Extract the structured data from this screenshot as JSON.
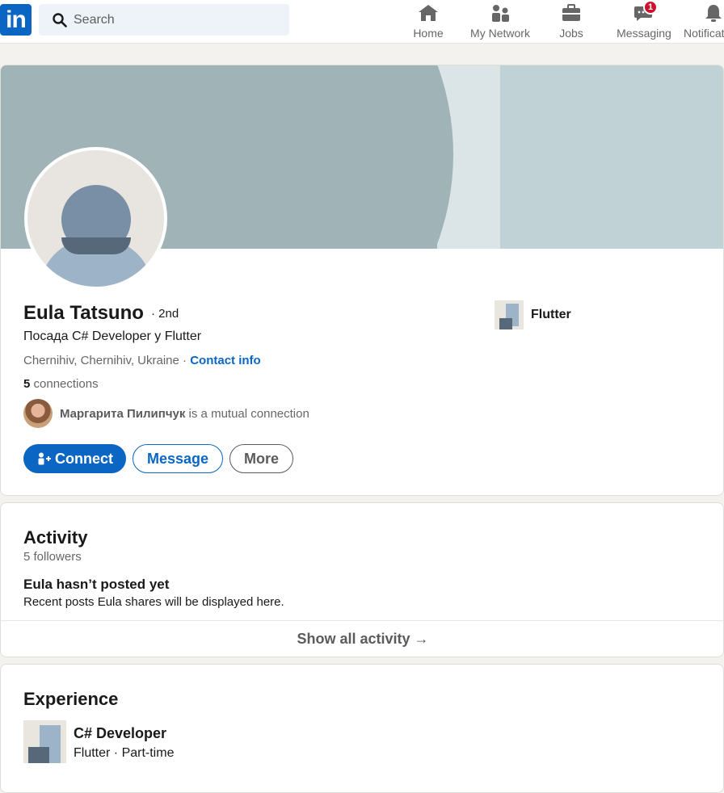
{
  "nav": {
    "logo": "in",
    "search_placeholder": "Search",
    "items": [
      {
        "label": "Home",
        "icon": "home-icon"
      },
      {
        "label": "My Network",
        "icon": "network-icon"
      },
      {
        "label": "Jobs",
        "icon": "briefcase-icon"
      },
      {
        "label": "Messaging",
        "icon": "messaging-icon",
        "badge": "1"
      },
      {
        "label": "Notifications",
        "icon": "bell-icon"
      }
    ]
  },
  "profile": {
    "name": "Eula Tatsuno",
    "degree": "· 2nd",
    "headline": "Посада C# Developer у Flutter",
    "location": "Chernihiv, Chernihiv, Ukraine",
    "location_sep": " · ",
    "contact_info": "Contact info",
    "connections_count": "5",
    "connections_label": " connections",
    "mutual_name": "Маргарита Пилипчук",
    "mutual_suffix": " is a mutual connection",
    "buttons": {
      "connect": "Connect",
      "message": "Message",
      "more": "More"
    },
    "company": "Flutter"
  },
  "activity": {
    "title": "Activity",
    "followers": "5 followers",
    "empty_title": "Eula hasn’t posted yet",
    "empty_desc": "Recent posts Eula shares will be displayed here.",
    "show_all": "Show all activity →"
  },
  "experience": {
    "title": "Experience",
    "items": [
      {
        "role": "C# Developer",
        "company_type": "Flutter · Part-time"
      }
    ]
  },
  "colors": {
    "brand": "#0a66c2",
    "badge": "#cb112d",
    "page_bg": "#f4f2ee"
  }
}
